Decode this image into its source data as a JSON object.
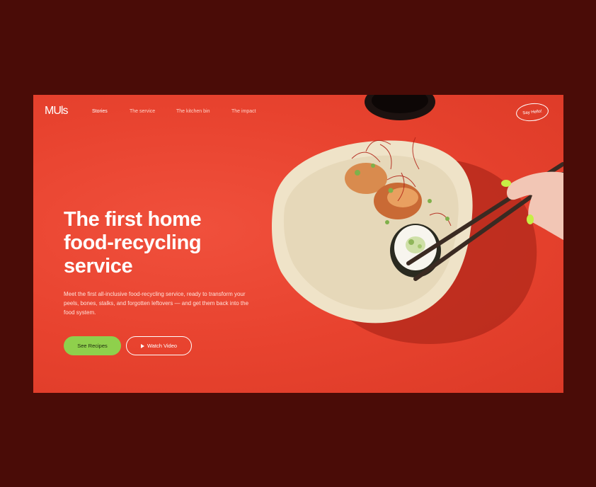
{
  "brand": {
    "logo_text": "MUls"
  },
  "nav": {
    "items": [
      {
        "label": "Stories",
        "active": true
      },
      {
        "label": "The service",
        "active": false
      },
      {
        "label": "The kitchen bin",
        "active": false
      },
      {
        "label": "The impact",
        "active": false
      }
    ],
    "cta_label": "Say Hello!"
  },
  "hero": {
    "headline_lines": [
      "The first home",
      "food-recycling",
      "service"
    ],
    "description": "Meet the first all-inclusive food-recycling service, ready to transform your peels, bones, stalks, and forgotten leftovers — and get them back into the food system.",
    "primary_button": "See Recipes",
    "secondary_button": "Watch Video"
  },
  "colors": {
    "background": "#4a0c07",
    "hero_red": "#e8432f",
    "accent_green": "#8fd04c"
  },
  "photo": {
    "subject": "sushi plate with chopsticks"
  }
}
